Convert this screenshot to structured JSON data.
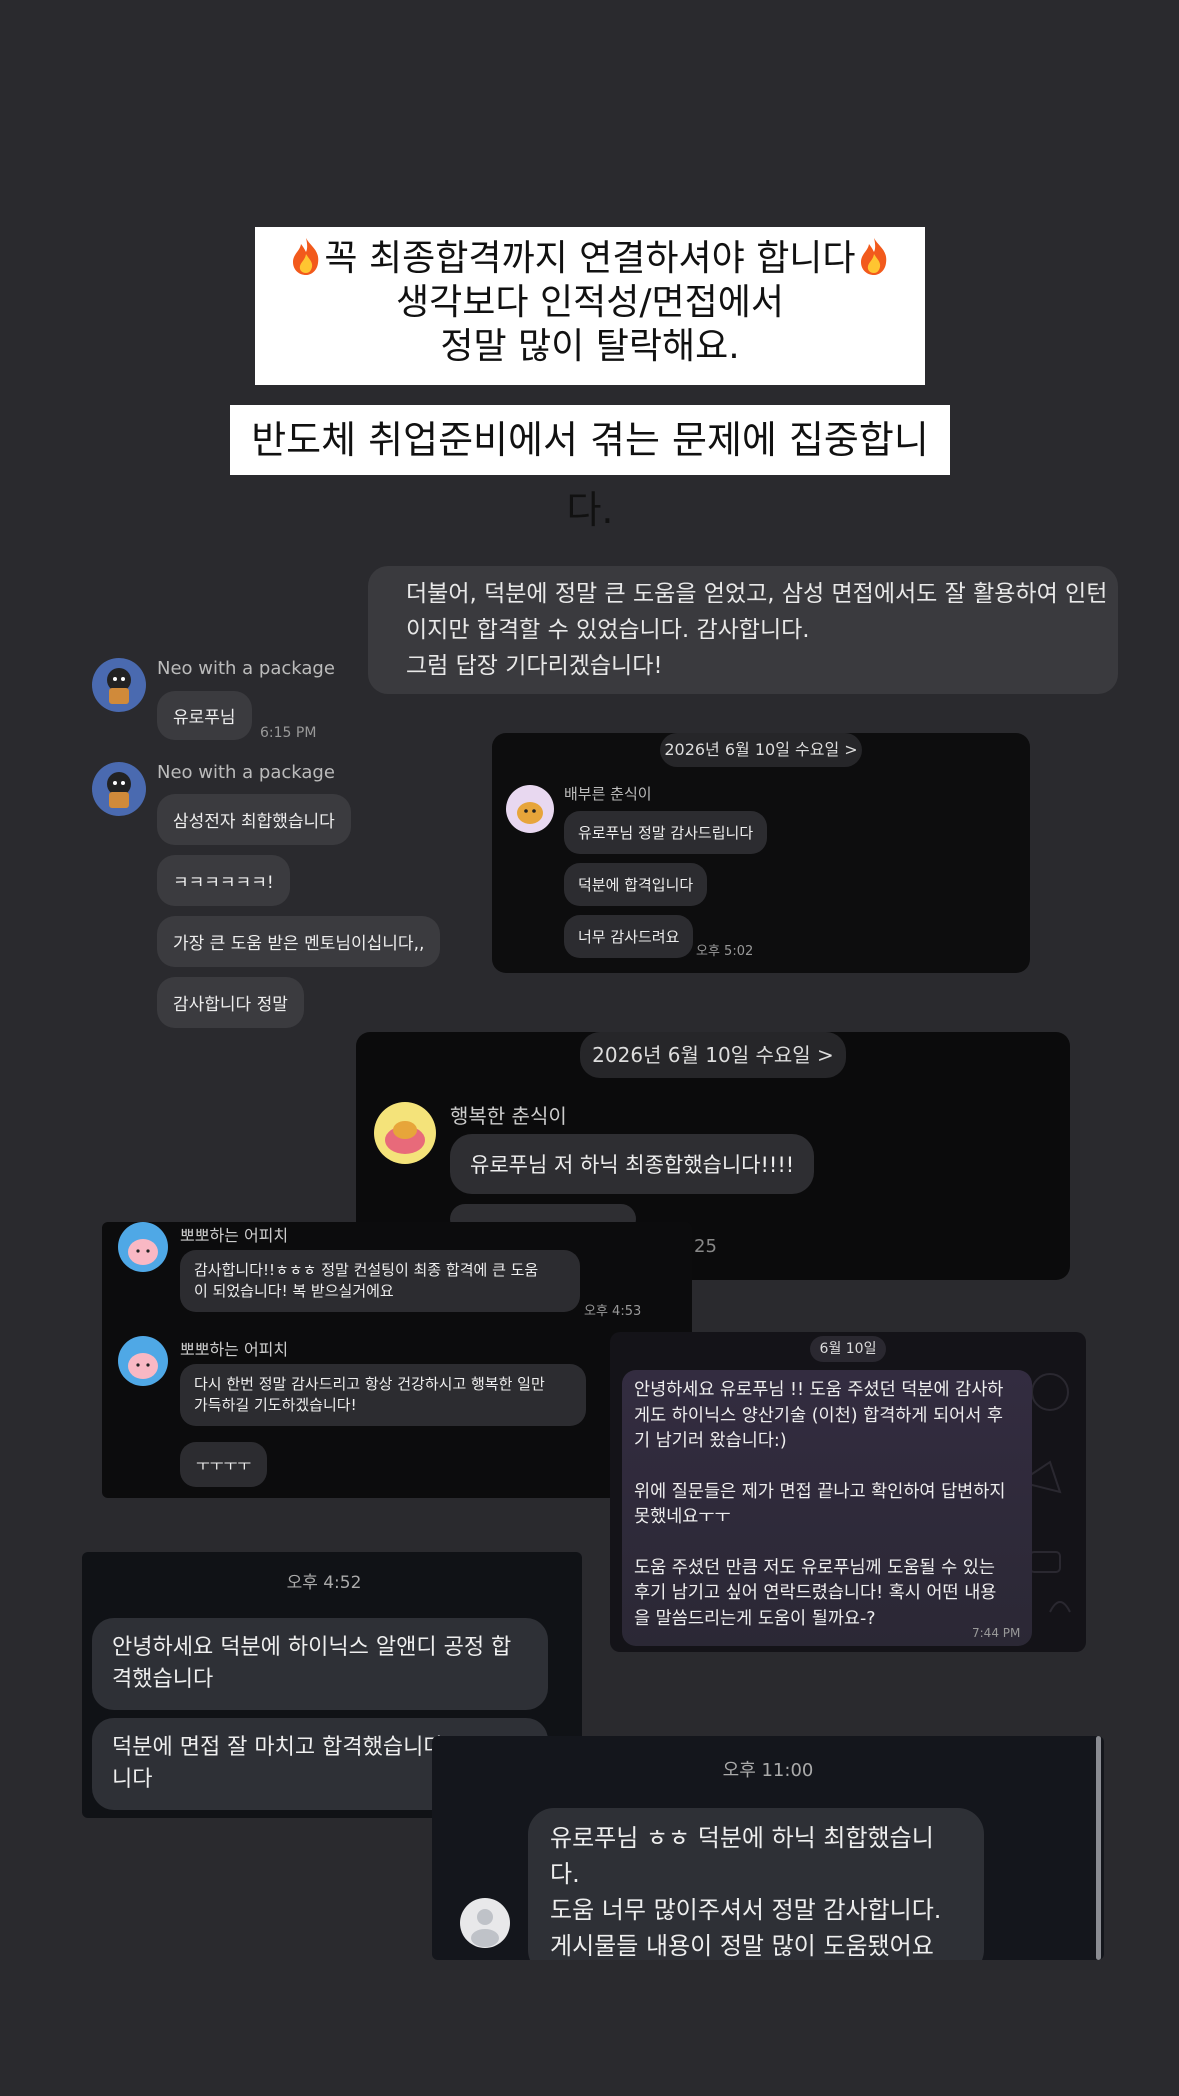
{
  "headlines": {
    "line1": "꼭 최종합격까지 연결하셔야 합니다",
    "line2": "생각보다 인적성/면접에서",
    "line3": "정말 많이 탈락해요.",
    "banner2": "반도체 취업준비에서 겪는 문제에 집중합니다."
  },
  "top_message": {
    "line1": "더불어, 덕분에 정말 큰 도움을 얻었고, 삼성 면접에서도 잘 활용하여 인턴",
    "line2": "이지만 합격할 수 있었습니다. 감사합니다.",
    "line3": "그럼 답장 기다리겠습니다!"
  },
  "chat_neo": {
    "sender1": "Neo with a package",
    "msg1": "유로푸님",
    "time1": "6:15 PM",
    "sender2": "Neo with a package",
    "msg2": "삼성전자 최합했습니다",
    "msg3": "ㅋㅋㅋㅋㅋㅋ!",
    "msg4": "가장 큰 도움 받은 멘토님이십니다,,",
    "msg5": "감사합니다 정말"
  },
  "chat_choonsik1": {
    "date": "2026년 6월 10일 수요일 >",
    "sender": "배부른 춘식이",
    "msg1": "유로푸님 정말 감사드립니다",
    "msg2": "덕분에 합격입니다",
    "msg3": "너무 감사드려요",
    "time": "오후 5:02"
  },
  "chat_choonsik2": {
    "date": "2026년 6월 10일 수요일 >",
    "sender": "행복한 춘식이",
    "msg1": "유로푸님 저 하닉 최종합했습니다!!!!",
    "partial_time": "25"
  },
  "chat_apeach": {
    "sender1": "뽀뽀하는 어피치",
    "msg1_line1": "감사합니다!!ㅎㅎㅎ 정말 컨설팅이 최종 합격에 큰 도움",
    "msg1_line2": "이 되었습니다! 복 받으실거에요",
    "time1": "오후 4:53",
    "sender2": "뽀뽀하는 어피치",
    "msg2_line1": "다시 한번 정말 감사드리고 항상 건강하시고 행복한 일만",
    "msg2_line2": "가득하길  기도하겠습니다!",
    "msg3": "ㅜㅜㅜㅜ"
  },
  "chat_telegram": {
    "date": "6월 10일",
    "line1": "안녕하세요 유로푸님 !! 도움 주셨던 덕분에 감사하",
    "line2": "게도 하이닉스 양산기술 (이천) 합격하게 되어서 후",
    "line3": "기 남기러 왔습니다:)",
    "line4": "위에 질문들은 제가 면접 끝나고 확인하여 답변하지",
    "line5": "못했네요ㅜㅜ",
    "line6": "도움 주셨던 만큼 저도 유로푸님께 도움될 수 있는",
    "line7": "후기 남기고 싶어 연락드렸습니다! 혹시 어떤 내용",
    "line8": "을 말씀드리는게 도움이 될까요-?",
    "time": "7:44 PM"
  },
  "chat_hynix": {
    "time": "오후 4:52",
    "msg1_line1": "안녕하세요 덕분에 하이닉스 알앤디 공정 합",
    "msg1_line2": "격했습니다",
    "msg2_line1": "덕분에 면접 잘 마치고 합격했습니다",
    "msg2_line2": "니다"
  },
  "chat_last": {
    "time": "오후 11:00",
    "line1": "유로푸님 ㅎㅎ 덕분에 하닉 최합했습니다.",
    "line2": "도움 너무 많이주셔서 정말 감사합니다.",
    "line3": "게시물들 내용이 정말 많이 도움됐어요"
  },
  "colors": {
    "background": "#2a2a2e",
    "bubble": "#3b3b3f",
    "panel": "#0c0c0d",
    "telegram_bubble": "#2f2a3a"
  }
}
